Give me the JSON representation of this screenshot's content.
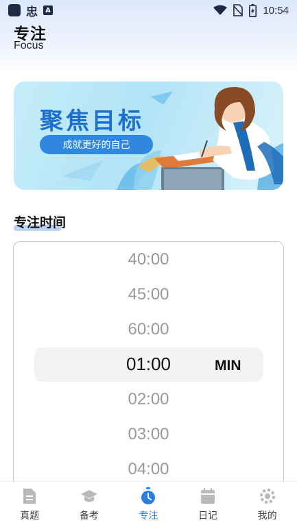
{
  "status_bar": {
    "time": "10:54",
    "char_glyph": "忠",
    "a_glyph": "A"
  },
  "header": {
    "title": "专注",
    "subtitle": "Focus"
  },
  "banner": {
    "title": "聚焦目标",
    "slogan": "成就更好的自己"
  },
  "section": {
    "title": "专注时间"
  },
  "picker": {
    "items": [
      "40:00",
      "45:00",
      "60:00",
      "01:00",
      "02:00",
      "03:00",
      "04:00"
    ],
    "selected_index": 3,
    "unit": "MIN"
  },
  "nav": {
    "items": [
      {
        "label": "真题",
        "icon": "document-icon"
      },
      {
        "label": "备考",
        "icon": "graduation-cap-icon"
      },
      {
        "label": "专注",
        "icon": "timer-icon",
        "active": true
      },
      {
        "label": "日记",
        "icon": "calendar-icon"
      },
      {
        "label": "我的",
        "icon": "gear-icon"
      }
    ]
  },
  "colors": {
    "accent": "#2b7fe0",
    "banner_title": "#1d6fcf",
    "inactive_icon": "#b9b9b9"
  }
}
